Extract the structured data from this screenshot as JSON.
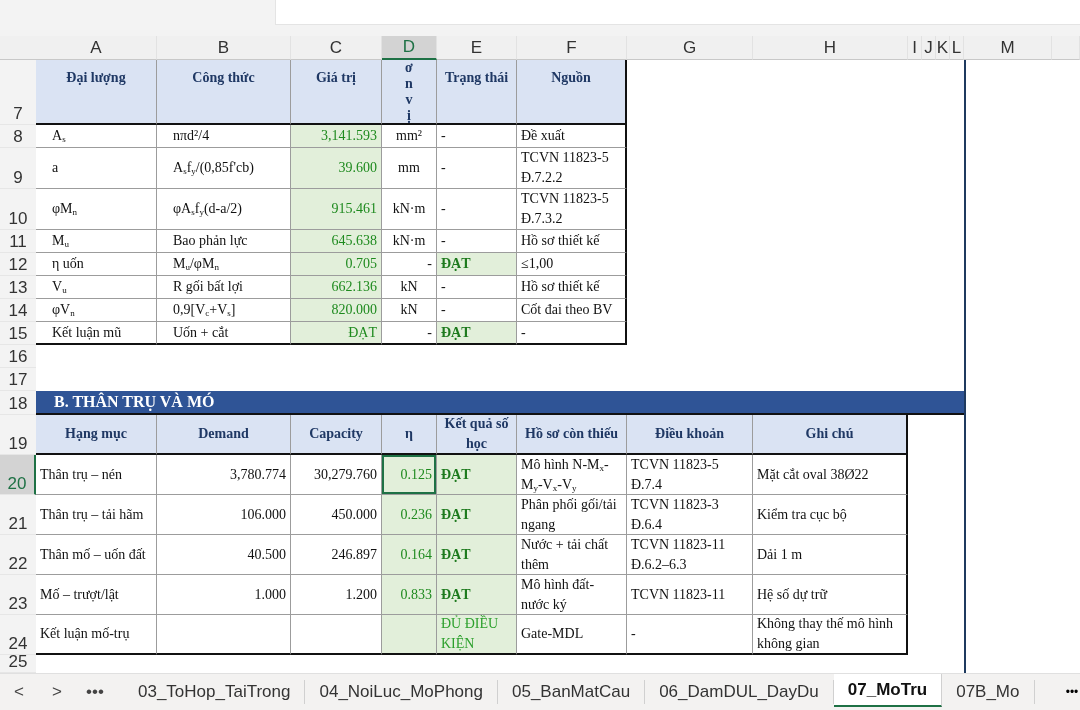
{
  "column_headers": [
    {
      "label": "A",
      "selected": false
    },
    {
      "label": "B",
      "selected": false
    },
    {
      "label": "C",
      "selected": false
    },
    {
      "label": "D",
      "selected": true
    },
    {
      "label": "E",
      "selected": false
    },
    {
      "label": "F",
      "selected": false
    },
    {
      "label": "G",
      "selected": false
    },
    {
      "label": "H",
      "selected": false
    },
    {
      "label": "I",
      "selected": false
    },
    {
      "label": "J",
      "selected": false
    },
    {
      "label": "K",
      "selected": false
    },
    {
      "label": "L",
      "selected": false
    },
    {
      "label": "M",
      "selected": false
    }
  ],
  "row_headers": [
    {
      "label": "7",
      "selected": false
    },
    {
      "label": "8",
      "selected": false
    },
    {
      "label": "9",
      "selected": false
    },
    {
      "label": "10",
      "selected": false
    },
    {
      "label": "11",
      "selected": false
    },
    {
      "label": "12",
      "selected": false
    },
    {
      "label": "13",
      "selected": false
    },
    {
      "label": "14",
      "selected": false
    },
    {
      "label": "15",
      "selected": false
    },
    {
      "label": "16",
      "selected": false
    },
    {
      "label": "17",
      "selected": false
    },
    {
      "label": "18",
      "selected": false
    },
    {
      "label": "19",
      "selected": false
    },
    {
      "label": "20",
      "selected": true
    },
    {
      "label": "21",
      "selected": false
    },
    {
      "label": "22",
      "selected": false
    },
    {
      "label": "23",
      "selected": false
    },
    {
      "label": "24",
      "selected": false
    },
    {
      "label": "25",
      "selected": false
    }
  ],
  "section_a": {
    "columns": [
      "Đại lượng",
      "Công thức",
      "Giá trị",
      "ơn vị",
      "Trạng thái",
      "Nguồn"
    ],
    "rows": [
      {
        "quantity": "A$_{s}$",
        "formula": "nπd²/4",
        "value": "3,141.593",
        "unit": "mm²",
        "status": "-",
        "status_pass": false,
        "source": "Đề xuất"
      },
      {
        "quantity": "a",
        "formula": "A$_{s}$f$_{y}$/(0,85f'cb)",
        "value": "39.600",
        "unit": "mm",
        "status": "-",
        "status_pass": false,
        "source": "TCVN 11823-5 Đ.7.2.2"
      },
      {
        "quantity": "φM$_{n}$",
        "formula": "φA$_{s}$f$_{y}$(d-a/2)",
        "value": "915.461",
        "unit": "kN·m",
        "status": "-",
        "status_pass": false,
        "source": "TCVN 11823-5 Đ.7.3.2"
      },
      {
        "quantity": "M$_{u}$",
        "formula": "Bao phản lực",
        "value": "645.638",
        "unit": "kN·m",
        "status": "-",
        "status_pass": false,
        "source": "Hồ sơ thiết kế"
      },
      {
        "quantity": "η uốn",
        "formula": "M$_{u}$/φM$_{n}$",
        "value": "0.705",
        "unit": "-",
        "status": "ĐẠT",
        "status_pass": true,
        "source": "≤1,00"
      },
      {
        "quantity": "V$_{u}$",
        "formula": "R gối bất lợi",
        "value": "662.136",
        "unit": "kN",
        "status": "-",
        "status_pass": false,
        "source": "Hồ sơ thiết kế"
      },
      {
        "quantity": "φV$_{n}$",
        "formula": "0,9[V$_{c}$+V$_{s}$]",
        "value": "820.000",
        "unit": "kN",
        "status": "-",
        "status_pass": false,
        "source": "Cốt đai theo BV"
      },
      {
        "quantity": "Kết luận mũ",
        "formula": "Uốn + cắt",
        "value": "ĐẠT",
        "unit": "-",
        "status": "ĐẠT",
        "status_pass": true,
        "source": "-"
      }
    ]
  },
  "section_b": {
    "title": "B. THÂN TRỤ VÀ MÓ",
    "columns": [
      "Hạng mục",
      "Demand",
      "Capacity",
      "η",
      "Kết quả số học",
      "Hồ sơ còn thiếu",
      "Điều khoản",
      "Ghi chú"
    ],
    "rows": [
      {
        "item": "Thân trụ – nén",
        "demand": "3,780.774",
        "capacity": "30,279.760",
        "eta": "0.125",
        "result": "ĐẠT",
        "result_bold": true,
        "missing": "Mô hình N-M$_{x}$-M$_{y}$-V$_{x}$-V$_{y}$",
        "clause": "TCVN 11823-5 Đ.7.4",
        "note": "Mặt cắt oval 38Ø22"
      },
      {
        "item": "Thân trụ – tải hãm",
        "demand": "106.000",
        "capacity": "450.000",
        "eta": "0.236",
        "result": "ĐẠT",
        "result_bold": true,
        "missing": "Phân phối gối/tải ngang",
        "clause": "TCVN 11823-3 Đ.6.4",
        "note": "Kiểm tra cục bộ"
      },
      {
        "item": "Thân mố – uốn đất",
        "demand": "40.500",
        "capacity": "246.897",
        "eta": "0.164",
        "result": "ĐẠT",
        "result_bold": true,
        "missing": "Nước + tải chất thêm",
        "clause": "TCVN 11823-11 Đ.6.2–6.3",
        "note": "Dải 1 m"
      },
      {
        "item": "Mố – trượt/lật",
        "demand": "1.000",
        "capacity": "1.200",
        "eta": "0.833",
        "result": "ĐẠT",
        "result_bold": true,
        "missing": "Mô hình đất-nước ký",
        "clause": "TCVN 11823-11",
        "note": "Hệ số dự trữ"
      },
      {
        "item": "Kết luận mố-trụ",
        "result": "ĐỦ ĐIỀU KIỆN",
        "result_bold": false,
        "missing": "Gate-MDL",
        "clause": "-",
        "note": "Không thay thế mô hình không gian"
      }
    ]
  },
  "sheet_tabs": {
    "nav": [
      "<",
      ">",
      "•••"
    ],
    "tabs": [
      {
        "label": "03_ToHop_TaiTrong",
        "selected": false
      },
      {
        "label": "04_NoiLuc_MoPhong",
        "selected": false
      },
      {
        "label": "05_BanMatCau",
        "selected": false
      },
      {
        "label": "06_DamDUL_DayDu",
        "selected": false
      },
      {
        "label": "07_MoTru",
        "selected": true
      },
      {
        "label": "07B_Mo",
        "selected": false
      }
    ],
    "more": "•••"
  }
}
